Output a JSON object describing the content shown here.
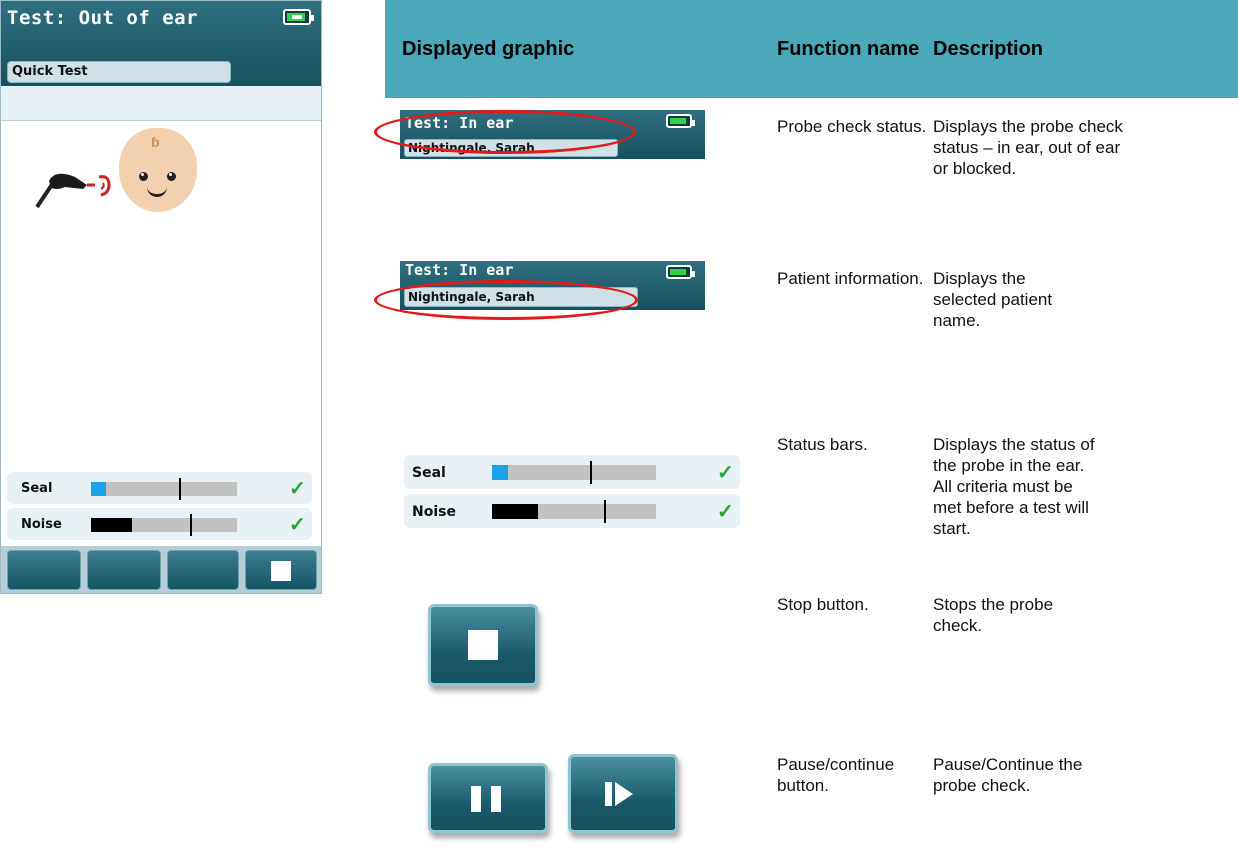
{
  "device": {
    "title": "Test: Out of ear",
    "patient": "Quick Test",
    "status_bars": [
      {
        "label": "Seal",
        "level": 0.1,
        "threshold": 0.6,
        "ok": true
      },
      {
        "label": "Noise",
        "level": 0.28,
        "threshold": 0.68,
        "ok": true
      }
    ]
  },
  "table": {
    "headers": [
      "Displayed graphic",
      "Function name",
      "Description"
    ],
    "rows": [
      {
        "function": "Probe check status.",
        "description": "Displays the probe check status – in ear, out of ear or blocked."
      },
      {
        "function": "Patient information.",
        "description": "Displays the selected patient name."
      },
      {
        "function": "Status bars.",
        "description": "Displays the status of the probe in the ear.  All criteria must be met before a test will start."
      },
      {
        "function": "Stop button.",
        "description": "Stops the probe check."
      },
      {
        "function": "Pause/continue button.",
        "description": "Pause/Continue the probe check."
      }
    ]
  },
  "graphics": {
    "probe_status_title": "Test: In ear",
    "probe_status_patient": "Nightingale, Sarah",
    "patient_info_title": "Test: In ear",
    "patient_info_name": "Nightingale, Sarah",
    "status_bars": [
      {
        "label": "Seal",
        "level": 0.1,
        "threshold": 0.6,
        "ok": true
      },
      {
        "label": "Noise",
        "level": 0.28,
        "threshold": 0.68,
        "ok": true
      }
    ]
  },
  "colors": {
    "header_teal": "#4ba8ba",
    "device_teal": "#17515f",
    "highlight_red": "#e21a1a",
    "seal_blue": "#1aa3e6",
    "noise_black": "#000000",
    "check_green": "#22a82e"
  },
  "icons": {
    "battery": "battery-charging-icon",
    "check": "checkmark-icon",
    "stop": "stop-icon",
    "pause": "pause-icon",
    "play": "play-icon"
  }
}
